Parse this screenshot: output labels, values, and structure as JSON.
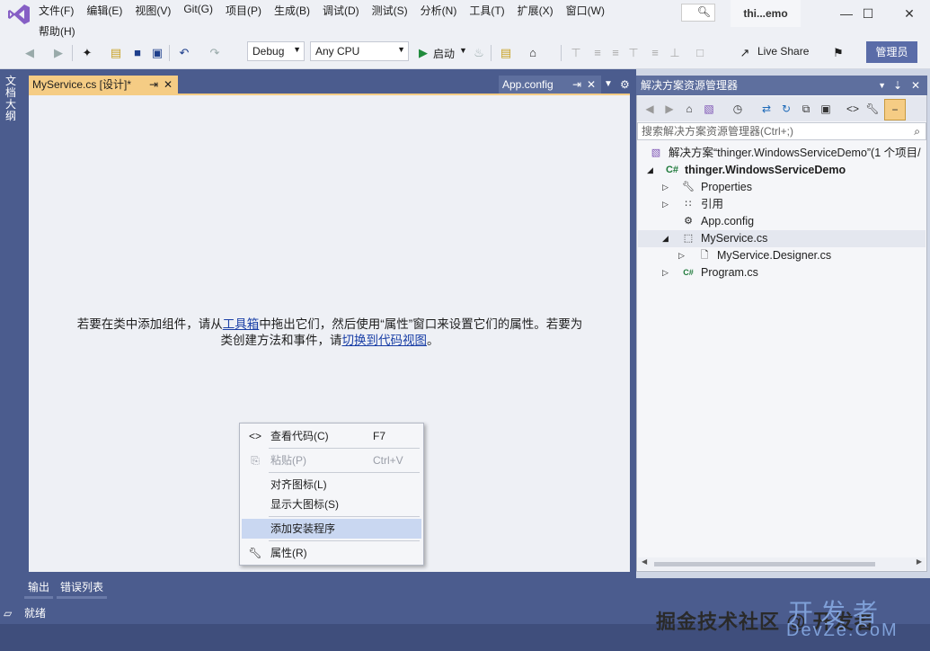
{
  "menu": {
    "items": [
      "文件(F)",
      "编辑(E)",
      "视图(V)",
      "Git(G)",
      "项目(P)",
      "生成(B)",
      "调试(D)",
      "测试(S)",
      "分析(N)",
      "工具(T)",
      "扩展(X)",
      "窗口(W)"
    ],
    "help": "帮助(H)"
  },
  "titlebar": {
    "solution_short": "thi...emo"
  },
  "toolbar": {
    "config": "Debug",
    "platform": "Any CPU",
    "start_label": "启动",
    "live_share": "Live Share",
    "admin": "管理员"
  },
  "left_strip": {
    "label": "文档大纲"
  },
  "tabs": {
    "active": "MyService.cs [设计]*",
    "inactive": "App.config"
  },
  "designer": {
    "hint_part1": "若要在类中添加组件，请从",
    "hint_link1": "工具箱",
    "hint_part2": "中拖出它们，然后使用“属性”窗口来设置它们的属性。若要为",
    "hint_part3": "类创建方法和事件，请",
    "hint_link2": "切换到代码视图",
    "hint_part4": "。"
  },
  "context_menu": {
    "view_code": "查看代码(C)",
    "view_code_key": "F7",
    "paste": "粘贴(P)",
    "paste_key": "Ctrl+V",
    "align_icons": "对齐图标(L)",
    "show_large_icons": "显示大图标(S)",
    "add_installer": "添加安装程序",
    "properties": "属性(R)"
  },
  "solution_explorer": {
    "title": "解决方案资源管理器",
    "search_placeholder": "搜索解决方案资源管理器(Ctrl+;)",
    "solution": "解决方案“thinger.WindowsServiceDemo”(1 个项目/",
    "project": "thinger.WindowsServiceDemo",
    "properties": "Properties",
    "references": "引用",
    "app_config": "App.config",
    "my_service": "MyService.cs",
    "my_service_designer": "MyService.Designer.cs",
    "program": "Program.cs"
  },
  "bottom_tabs": {
    "output": "输出",
    "error_list": "错误列表"
  },
  "status": {
    "ready": "就绪"
  },
  "watermark": {
    "line1": "掘金技术社区 @ 开发者",
    "line2": "开发者",
    "line3": "DevZe.CoM"
  }
}
